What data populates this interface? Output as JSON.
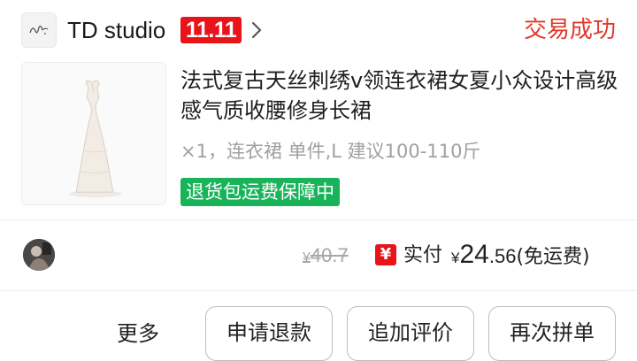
{
  "shop": {
    "name": "TD studio",
    "badge": "11.11",
    "logo_icon": "shop-logo-icon",
    "chevron_icon": "chevron-right-icon"
  },
  "order": {
    "status": "交易成功",
    "status_color": "#e0392b"
  },
  "product": {
    "title": "法式复古天丝刺绣v领连衣裙女夏小众设计高级感气质收腰修身长裙",
    "sku": "×1，连衣裙 单件,L 建议100-110斤",
    "guarantee": "退货包运费保障中",
    "guarantee_color": "#19b45a",
    "thumb_icon": "white-dress-image"
  },
  "price": {
    "original_currency": "¥",
    "original": "40.7",
    "paid_icon": "yen-icon",
    "paid_label": "实付",
    "currency": "¥",
    "paid_int": "24",
    "paid_dec": ".56",
    "shipping_note": "(免运费)"
  },
  "actions": {
    "more": "更多",
    "refund": "申请退款",
    "review": "追加评价",
    "rebuy": "再次拼单"
  }
}
